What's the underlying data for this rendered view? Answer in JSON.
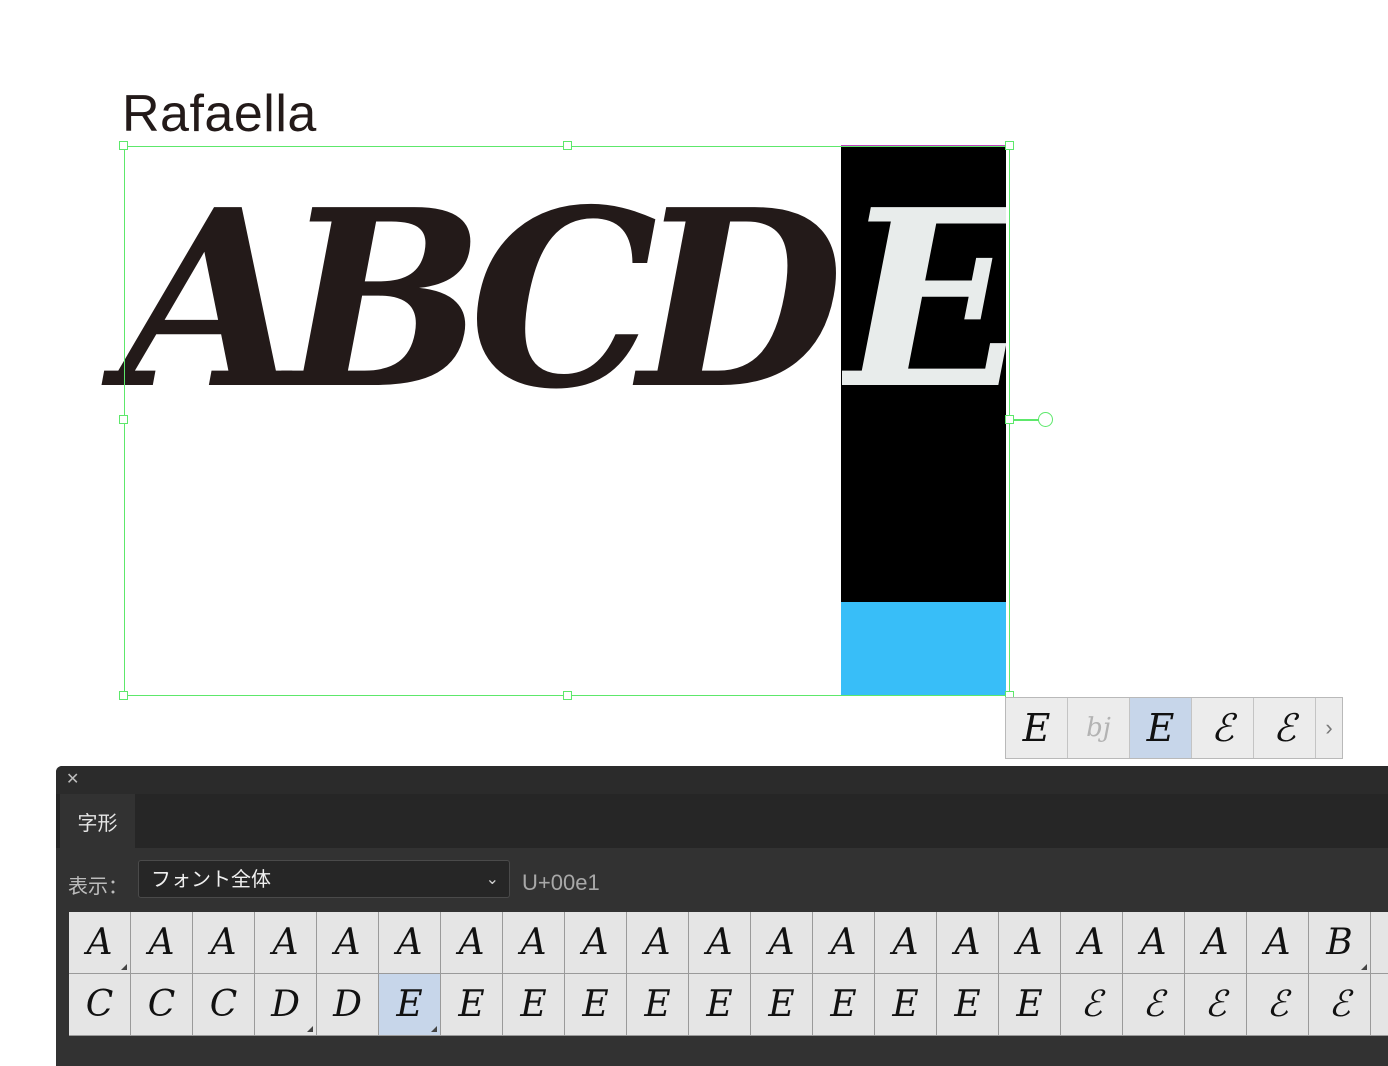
{
  "canvas": {
    "font_name_label": "Rafaella",
    "glyph_text": "ABCD",
    "highlighted_glyph": "E",
    "colors": {
      "text": "#231a19",
      "highlight_bg": "#000000",
      "blue_swatch": "#38bef8",
      "selection": "#5de86b"
    }
  },
  "alternates_popup": {
    "glyphs": [
      "E",
      "bj",
      "E",
      "ℰ",
      "ℰ"
    ],
    "selected_index": 2,
    "more_icon": "chevron-right-icon"
  },
  "glyph_panel": {
    "close_icon": "close-icon",
    "tab_label": "字形",
    "show_label": "表示：",
    "show_value": "フォント全体",
    "unicode_value": "U+00e1",
    "rows": [
      [
        "A",
        "A",
        "A",
        "A",
        "A",
        "A",
        "A",
        "A",
        "A",
        "A",
        "A",
        "A",
        "A",
        "A",
        "A",
        "A",
        "A",
        "A",
        "A",
        "A",
        "B",
        ""
      ],
      [
        "C",
        "C",
        "C",
        "D",
        "D",
        "E",
        "E",
        "E",
        "E",
        "E",
        "E",
        "E",
        "E",
        "E",
        "E",
        "E",
        "ℰ",
        "ℰ",
        "ℰ",
        "ℰ",
        "ℰ",
        ""
      ]
    ],
    "selected_cell": "E"
  }
}
